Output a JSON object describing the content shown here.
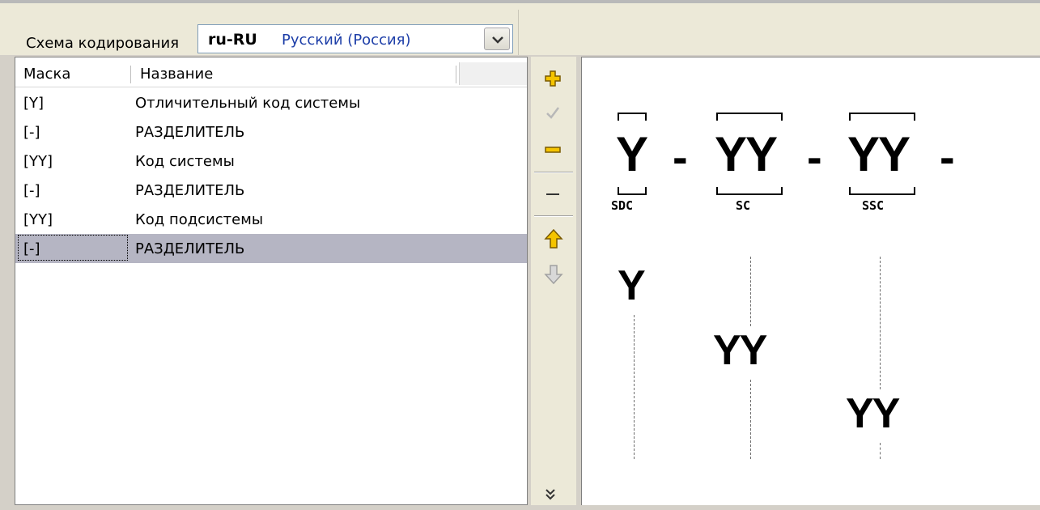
{
  "toolbar": {
    "scheme_label": "Схема кодирования",
    "combo": {
      "code": "ru-RU",
      "name": "Русский (Россия)"
    }
  },
  "grid": {
    "headers": {
      "mask": "Маска",
      "name": "Название"
    },
    "rows": [
      {
        "mask": "[Y]",
        "name": "Отличительный код системы"
      },
      {
        "mask": "[-]",
        "name": "РАЗДЕЛИТЕЛЬ"
      },
      {
        "mask": "[YY]",
        "name": "Код системы"
      },
      {
        "mask": "[-]",
        "name": "РАЗДЕЛИТЕЛЬ"
      },
      {
        "mask": "[YY]",
        "name": "Код подсистемы"
      },
      {
        "mask": "[-]",
        "name": "РАЗДЕЛИТЕЛЬ"
      }
    ],
    "selected_index": 5
  },
  "tools": [
    {
      "icon": "add-icon"
    },
    {
      "icon": "check-icon"
    },
    {
      "icon": "remove-icon"
    },
    {
      "icon": "dash-icon"
    },
    {
      "icon": "move-up-icon"
    },
    {
      "icon": "move-down-icon"
    },
    {
      "icon": "more-chevron-icon"
    }
  ],
  "preview": {
    "segments": [
      {
        "text": "Y",
        "label": "SDC"
      },
      {
        "text": "YY",
        "label": "SC"
      },
      {
        "text": "YY",
        "label": "SSC"
      }
    ],
    "separator": "-",
    "hierarchy": [
      "Y",
      "YY",
      "YY"
    ]
  },
  "colors": {
    "selection": "#b5b5c3",
    "window_bg": "#ece9d8",
    "combo_name": "#1d3ea8",
    "accent_icon": "#f2c200"
  }
}
